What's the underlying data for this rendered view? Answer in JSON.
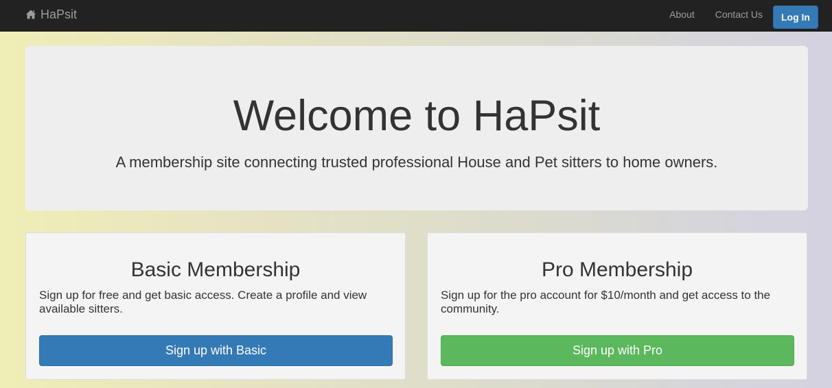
{
  "navbar": {
    "brand": "HaPsit",
    "brand_icon": "home-icon",
    "links": [
      "About",
      "Contact Us"
    ],
    "login_label": "Log In"
  },
  "hero": {
    "title": "Welcome to HaPsit",
    "subtitle": "A membership site connecting trusted professional House and Pet sitters to home owners."
  },
  "plans": {
    "basic": {
      "title": "Basic Membership",
      "description": "Sign up for free and get basic access. Create a profile and view available sitters.",
      "button_label": "Sign up with Basic",
      "button_color": "#337ab7"
    },
    "pro": {
      "title": "Pro Membership",
      "description": "Sign up for the pro account for $10/month and get access to the community.",
      "button_label": "Sign up with Pro",
      "button_color": "#5cb85c"
    }
  },
  "colors": {
    "navbar_bg": "#222222",
    "nav_text": "#9d9d9d",
    "jumbotron_bg": "#eeeeee",
    "card_bg": "#f4f4f4"
  }
}
